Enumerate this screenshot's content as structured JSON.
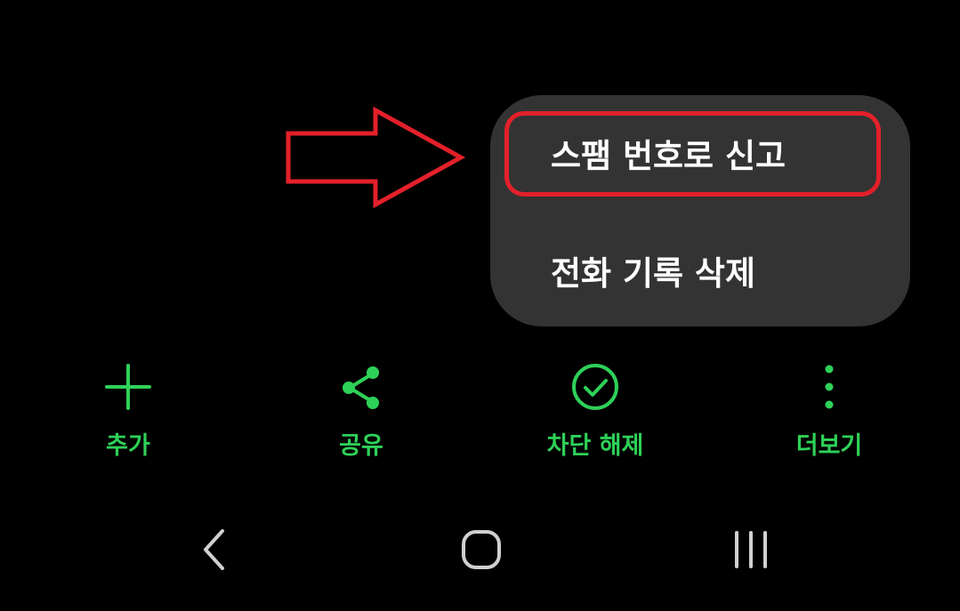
{
  "popup_menu": {
    "items": [
      {
        "label": "스팸 번호로 신고",
        "highlighted": true
      },
      {
        "label": "전화 기록 삭제",
        "highlighted": false
      }
    ]
  },
  "action_bar": {
    "add_label": "추가",
    "share_label": "공유",
    "unblock_label": "차단 해제",
    "more_label": "더보기"
  },
  "icons": {
    "add": "plus-icon",
    "share": "share-icon",
    "unblock": "check-circle-icon",
    "more": "more-vertical-icon",
    "nav_back": "chevron-left-icon",
    "nav_home": "home-icon",
    "nav_recents": "recents-icon"
  },
  "colors": {
    "background": "#000000",
    "menu_background": "#333333",
    "menu_text": "#ffffff",
    "action_accent": "#2ed158",
    "annotation_red": "#e3202a",
    "nav_icon": "#d0d0d0"
  }
}
